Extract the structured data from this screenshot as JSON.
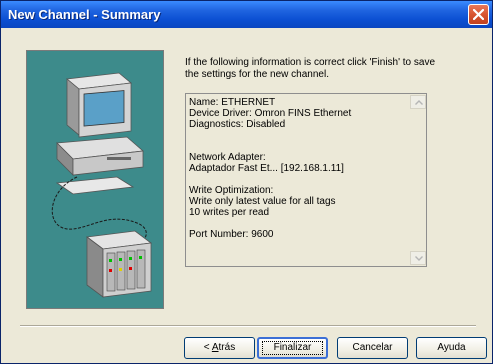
{
  "window": {
    "title": "New Channel - Summary"
  },
  "intro_text": "If the following information is correct click 'Finish' to save the settings for the new channel.",
  "summary": {
    "name": "Name: ETHERNET",
    "device_driver": "Device Driver: Omron FINS Ethernet",
    "diagnostics": "Diagnostics: Disabled",
    "network_adapter_label": "Network Adapter:",
    "network_adapter_value": "Adaptador Fast Et... [192.168.1.11]",
    "write_optimization_label": "Write Optimization:",
    "write_optimization_mode": "Write only latest value for all tags",
    "write_optimization_rate": "10 writes per read",
    "port_number": "Port Number: 9600"
  },
  "buttons": {
    "back_prefix": "< ",
    "back_mnemonic": "A",
    "back_rest": "trás",
    "finish": "Finalizar",
    "cancel": "Cancelar",
    "help": "Ayuda"
  },
  "colors": {
    "titlebar": "#0b4fd2",
    "illustration_bg": "#3d8b8b",
    "dialog_bg": "#ece9d8"
  }
}
